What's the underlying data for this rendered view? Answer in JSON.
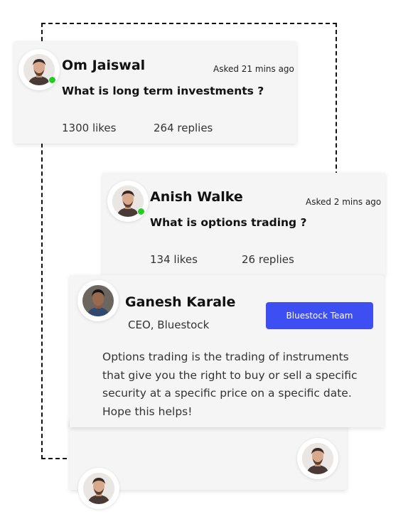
{
  "questions": [
    {
      "name": "Om Jaiswal",
      "asked": "Asked 21 mins ago",
      "question": "What is long term investments ?",
      "likes": "1300 likes",
      "replies": "264 replies"
    },
    {
      "name": "Anish Walke",
      "asked": "Asked 2 mins ago",
      "question": "What is options trading ?",
      "likes": "134 likes",
      "replies": "26 replies"
    }
  ],
  "answer": {
    "name": "Ganesh Karale",
    "title": "CEO, Bluestock",
    "badge": "Bluestock Team",
    "text": "Options trading is the trading of instruments that give you the right to buy or sell a specific security at a specific price on a specific date. Hope this helps!"
  },
  "colors": {
    "accent": "#3d4ff2",
    "online": "#22cc22",
    "card": "#f5f5f5"
  }
}
